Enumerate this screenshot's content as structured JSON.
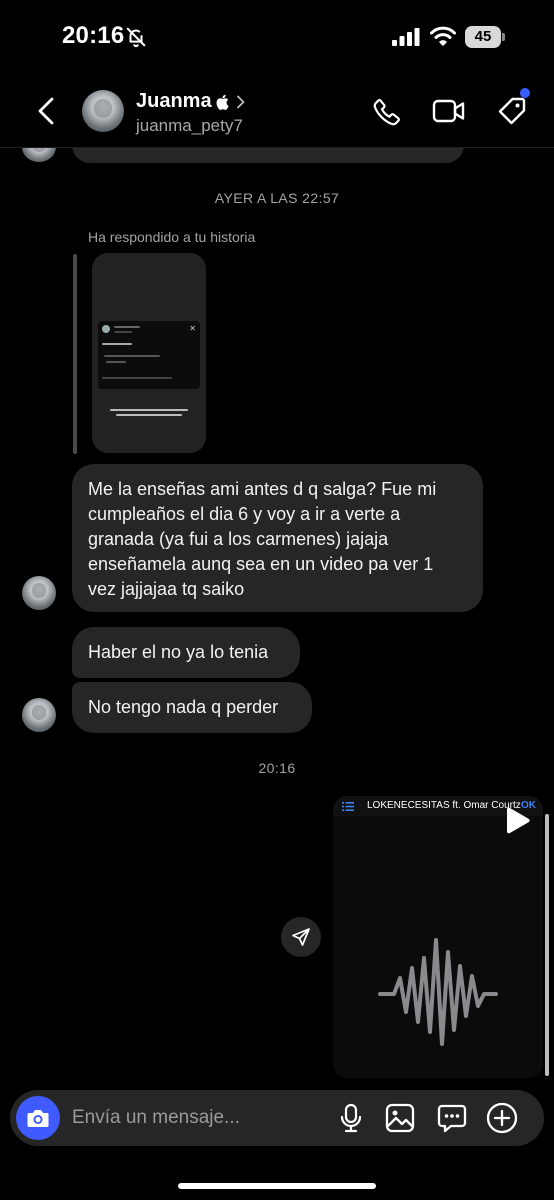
{
  "status_bar": {
    "time": "20:16",
    "battery": "45",
    "icons": [
      "bell-off-icon",
      "signal-icon",
      "wifi-icon",
      "battery-icon"
    ]
  },
  "header": {
    "name": "Juanma",
    "username": "juanma_pety7",
    "icons": [
      "back-arrow-icon",
      "apple-icon",
      "chevron-right-icon",
      "phone-icon",
      "video-camera-icon",
      "tag-icon"
    ],
    "accent_dot_color": "#3a5cff"
  },
  "chat": {
    "separator_1": "AYER A LAS 22:57",
    "reply_label": "Ha respondido a tu historia",
    "messages": [
      "Me la enseñas ami antes d q salga? Fue mi cumpleaños el dia 6 y voy a ir a verte a granada (ya fui a los carmenes) jajaja enseñamela aunq sea en un video pa ver 1 vez jajjajaa tq saiko",
      "Haber el no ya lo tenia",
      "No tengo nada q perder"
    ],
    "separator_2": "20:16",
    "media": {
      "title": "LOKENECESITAS ft. Omar Courtz",
      "ok": "OK",
      "icons": [
        "list-icon",
        "play-icon",
        "waveform-icon",
        "share-icon"
      ]
    },
    "bubble_color": "#262626"
  },
  "composer": {
    "placeholder": "Envía un mensaje...",
    "icons": [
      "camera-icon",
      "microphone-icon",
      "gallery-icon",
      "sticker-icon",
      "plus-icon"
    ],
    "camera_color": "#3f5bff"
  }
}
